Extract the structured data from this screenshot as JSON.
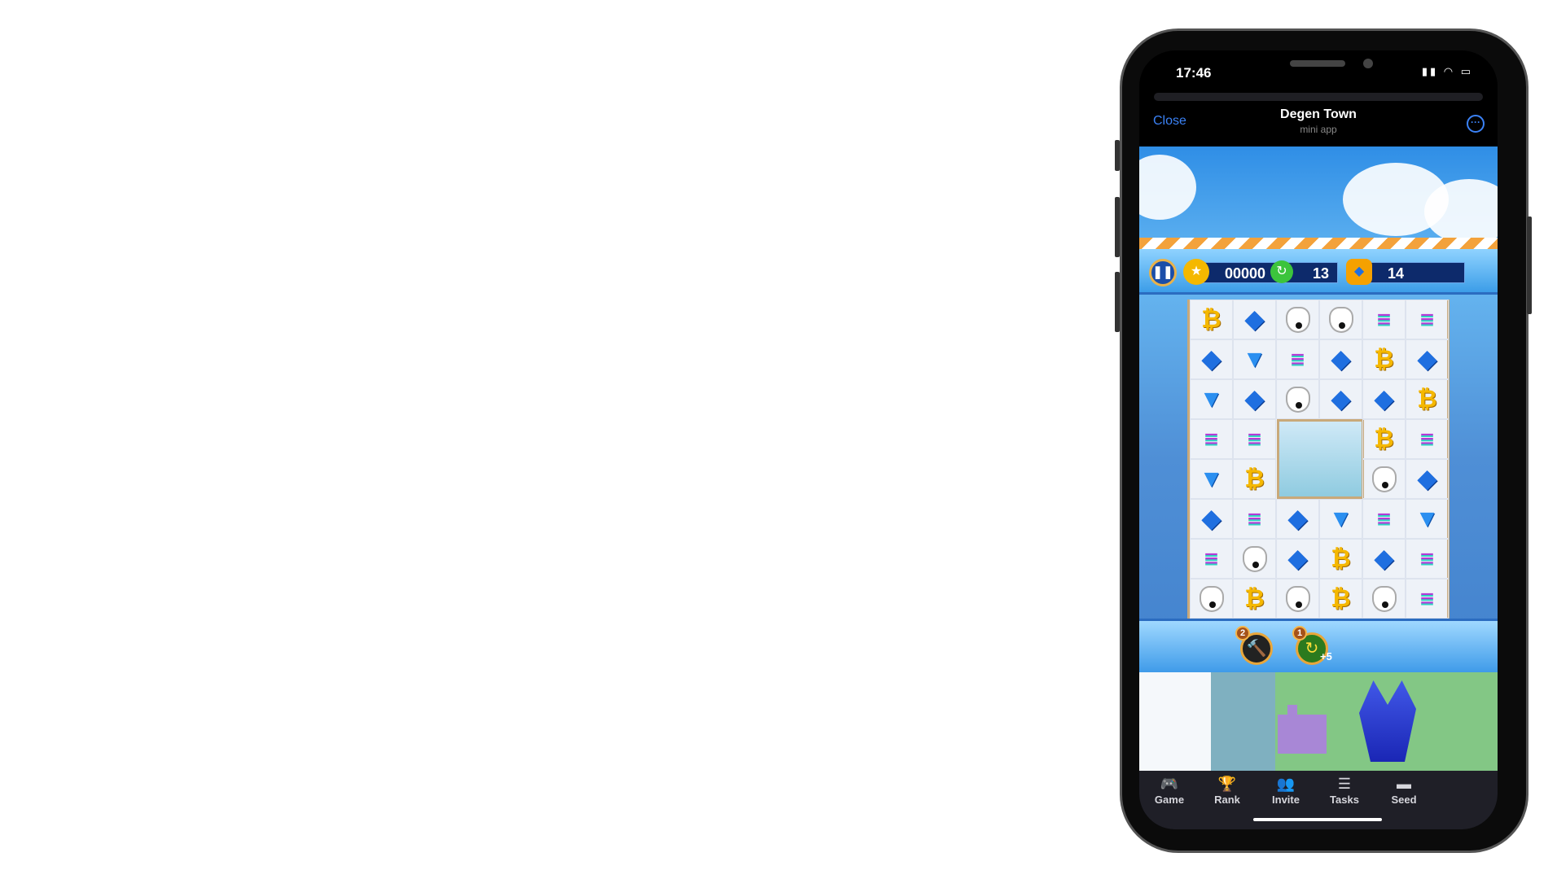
{
  "status": {
    "time": "17:46",
    "icons": "▮▮ ◠ ▭"
  },
  "header": {
    "close": "Close",
    "title": "Degen Town",
    "subtitle": "mini app",
    "more": "···"
  },
  "hud": {
    "pause": "❚❚",
    "coins": "00000",
    "moves": "13",
    "target": "14"
  },
  "grid": [
    [
      "btc",
      "eth",
      "dog",
      "dog",
      "sol",
      "sol"
    ],
    [
      "eth",
      "ton",
      "sol",
      "eth",
      "btc",
      "eth"
    ],
    [
      "ton",
      "eth",
      "dog",
      "eth",
      "eth",
      "btc"
    ],
    [
      "sol",
      "sol",
      "blocked",
      "blocked",
      "btc",
      "sol"
    ],
    [
      "ton",
      "btc",
      "blocked",
      "blocked",
      "dog",
      "eth"
    ],
    [
      "eth",
      "sol",
      "eth",
      "ton",
      "sol",
      "ton"
    ],
    [
      "sol",
      "dog",
      "eth",
      "btc",
      "eth",
      "sol"
    ],
    [
      "dog",
      "btc",
      "dog",
      "btc",
      "dog",
      "sol"
    ]
  ],
  "boosters": [
    {
      "name": "hammer",
      "count": "2"
    },
    {
      "name": "extra-moves",
      "count": "1",
      "bonus": "+5"
    }
  ],
  "tabs": [
    {
      "label": "Game",
      "icon": "🎮"
    },
    {
      "label": "Rank",
      "icon": "🏆"
    },
    {
      "label": "Invite",
      "icon": "👥"
    },
    {
      "label": "Tasks",
      "icon": "☰"
    },
    {
      "label": "Seed",
      "icon": "▬"
    }
  ]
}
